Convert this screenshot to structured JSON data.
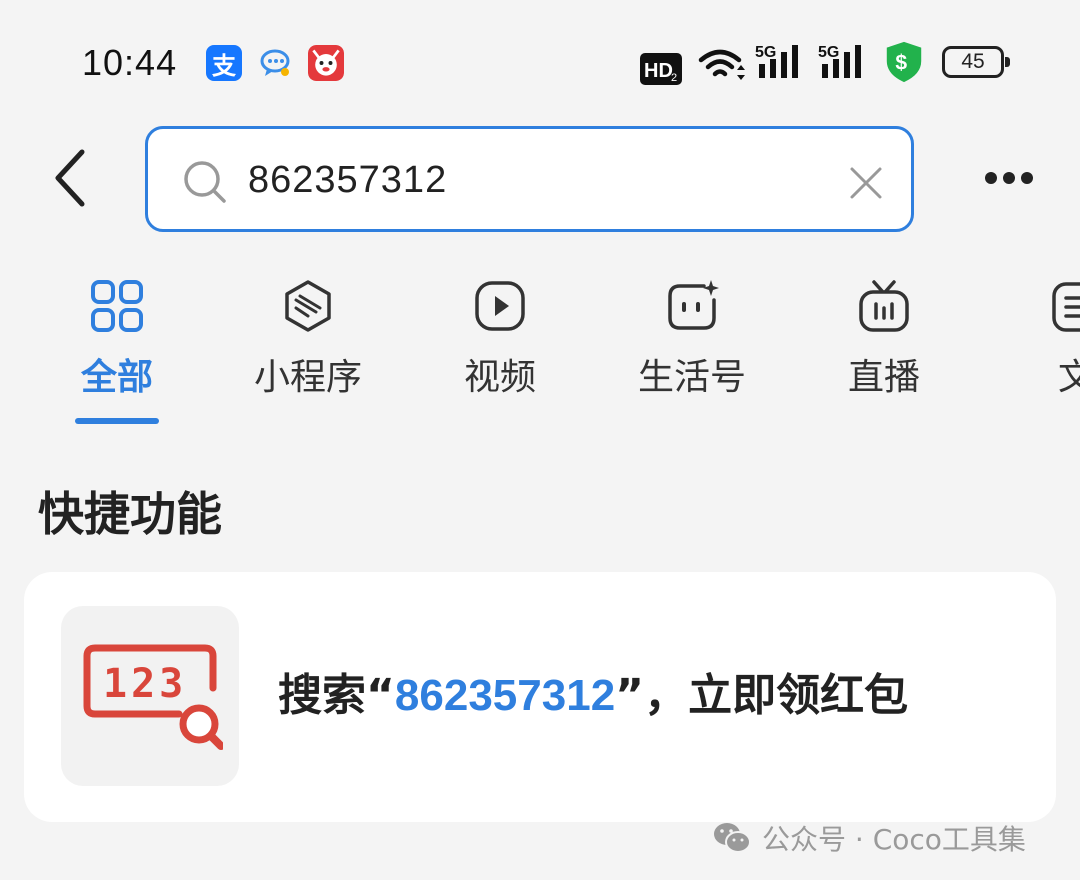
{
  "status_bar": {
    "time": "10:44",
    "battery_level": "45",
    "hd_badge": "HD",
    "network_labels": [
      "5G",
      "5G"
    ],
    "alipay_glyph": "支",
    "shield_glyph": "$",
    "notification_icons": [
      "alipay-icon",
      "chat-bubble-icon",
      "jd-mascot-icon"
    ],
    "system_icons": [
      "hd-voice-icon",
      "wifi-icon",
      "signal-5g-icon",
      "signal-5g-icon",
      "security-shield-icon",
      "battery-icon"
    ]
  },
  "search": {
    "query": "862357312",
    "back_icon": "chevron-left-icon",
    "clear_icon": "close-icon",
    "more_icon": "more-dots-icon"
  },
  "tabs": [
    {
      "label": "全部",
      "icon": "grid-icon",
      "active": true
    },
    {
      "label": "小程序",
      "icon": "mini-program-icon",
      "active": false
    },
    {
      "label": "视频",
      "icon": "play-icon",
      "active": false
    },
    {
      "label": "生活号",
      "icon": "life-account-icon",
      "active": false
    },
    {
      "label": "直播",
      "icon": "live-tv-icon",
      "active": false
    },
    {
      "label": "文",
      "icon": "article-icon",
      "active": false
    }
  ],
  "quick_functions": {
    "title": "快捷功能",
    "card": {
      "prefix": "搜索“",
      "keyword": "862357312",
      "suffix": "”，立即领红包",
      "icon": "number-search-icon",
      "icon_digits": "123"
    }
  },
  "watermark": {
    "text": "公众号 · Coco工具集",
    "icon": "wechat-icon"
  },
  "colors": {
    "accent": "#2f7fde",
    "background": "#f4f4f4",
    "icon_red": "#d9463b",
    "alipay_blue": "#1677ff",
    "shield_green": "#22b24c"
  }
}
